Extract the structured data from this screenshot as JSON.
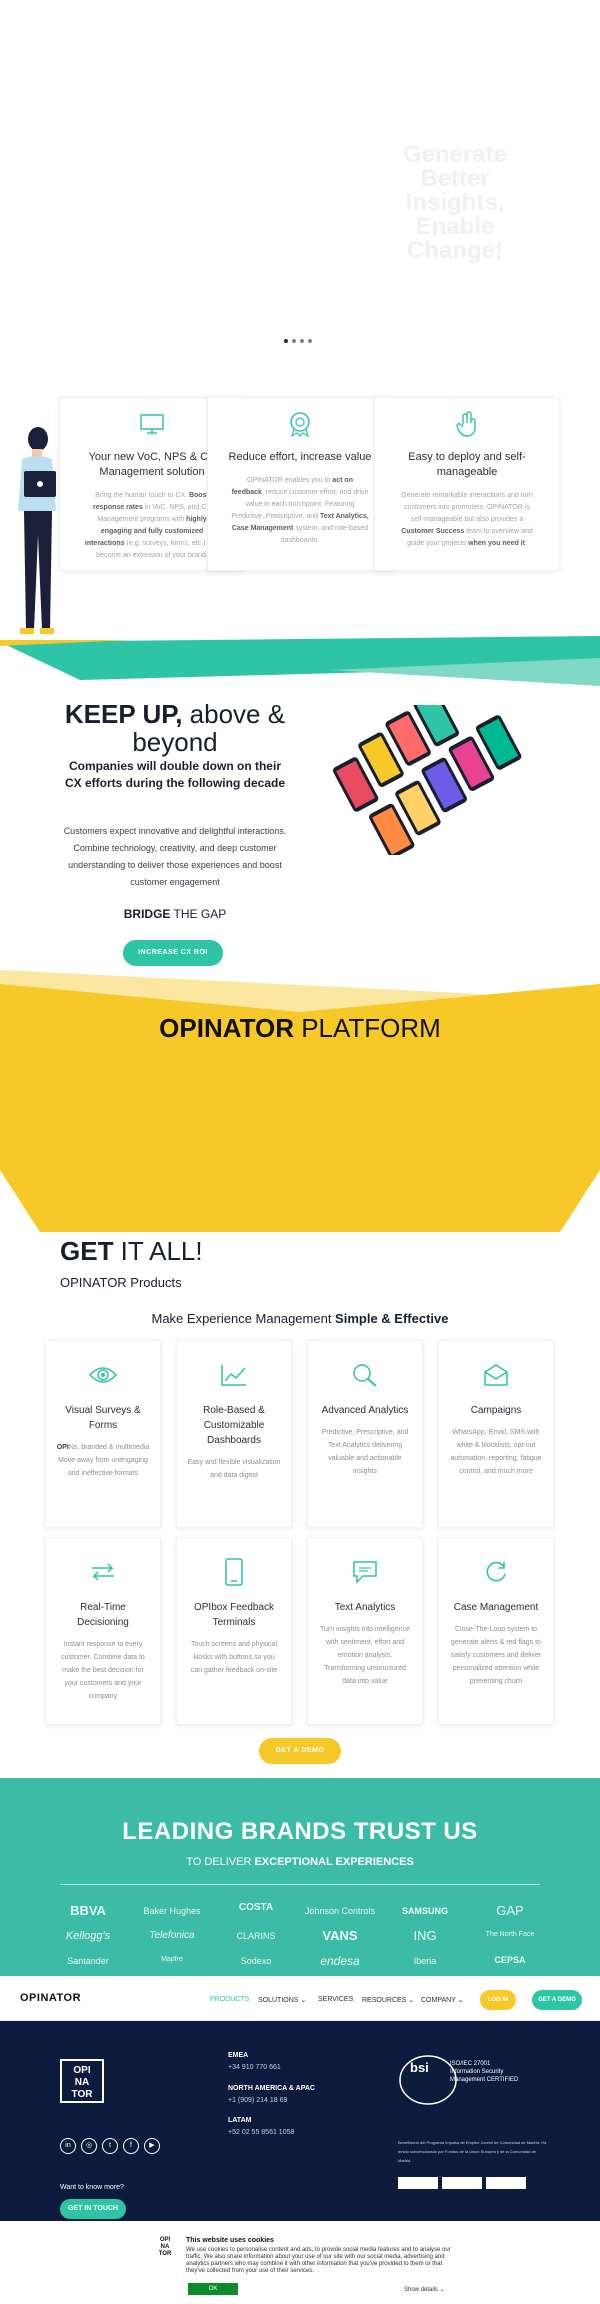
{
  "hero": {
    "lines": [
      "Generate",
      "Better",
      "Insights,",
      "Enable",
      "Change!"
    ]
  },
  "features": [
    {
      "icon": "monitor-icon",
      "title": "Your new VoC, NPS & CX Management solution",
      "desc": [
        "Bring the human touch to CX.",
        "Boost response rates",
        "in VoC, NPS, and CX Management programs with",
        "highly engaging and fully customized interactions",
        "(e.g. surveys, forms, etc.) that become an extension of your brand."
      ]
    },
    {
      "icon": "badge-icon",
      "title": "Reduce effort, increase value",
      "desc": [
        "OPINATOR enables you to",
        "act on feedback",
        ", reduce customer effort, and drive value in each touchpoint. Featuring Predictive, Prescriptive, and",
        "Text Analytics, Case Management",
        "system, and role-based dashboards."
      ]
    },
    {
      "icon": "hand-icon",
      "title": "Easy to deploy and self-manageable",
      "desc": [
        "Generate remarkable interactions and turn customers into promoters. OPINATOR is self-manageable but also provides a",
        "Customer Success",
        "team to overview and guide your projects",
        "when you need it",
        "."
      ]
    }
  ],
  "keepup": {
    "title_bold": "KEEP UP,",
    "title_rest": " above & beyond",
    "subtitle": "Companies will double down on their CX efforts during the following decade",
    "description": "Customers expect innovative and delightful interactions. Combine technology, creativity, and deep customer understanding to deliver those experiences and boost customer engagement",
    "bridge_bold": "BRIDGE",
    "bridge_rest": " THE GAP",
    "cta": "INCREASE CX ROI"
  },
  "platform": {
    "bold": "OPINATOR",
    "rest": " PLATFORM"
  },
  "getall": {
    "title_bold": "GET",
    "title_rest": " IT ALL!",
    "subtitle": "OPINATOR Products",
    "tag_rest": "Make Experience Management ",
    "tag_bold": "Simple & Effective"
  },
  "products": [
    {
      "icon": "eye-icon",
      "title": "Visual Surveys & Forms",
      "desc_bold": "OPI",
      "desc": "Ns, branded & multimedia Move away from unengaging and ineffective formats"
    },
    {
      "icon": "chart-line-icon",
      "title": "Role-Based & Customizable Dashboards",
      "desc_bold": "",
      "desc": "Easy and flexible visualization and data digest"
    },
    {
      "icon": "magnifier-icon",
      "title": "Advanced Analytics",
      "desc_bold": "",
      "desc": "Predictive, Prescriptive, and Text Analytics delivering valuable and actionable insights"
    },
    {
      "icon": "envelope-icon",
      "title": "Campaigns",
      "desc_bold": "",
      "desc": "WhatsApp, Email, SMS with white & blocklists, opt-out automation, reporting, fatigue control, and much more"
    },
    {
      "icon": "arrows-icon",
      "title": "Real-Time Decisioning",
      "desc_bold": "",
      "desc": "Instant response to every customer. Combine data to make the best decision for your customers and your company"
    },
    {
      "icon": "tablet-icon",
      "title": "OPIbox Feedback Terminals",
      "desc_bold": "",
      "desc": "Touch screens and physical kiosks with buttons so you can gather feedback on-site"
    },
    {
      "icon": "speech-bubble-icon",
      "title": "Text Analytics",
      "desc_bold": "",
      "desc": "Turn insights into intelligence with sentiment, effort and emotion analysis. Transforming unstructured data into value"
    },
    {
      "icon": "refresh-icon",
      "title": "Case Management",
      "desc_bold": "",
      "desc": "Close-The-Loop system to generate alerts & red flags to satisfy customers and deliver personalized attention while preventing churn"
    }
  ],
  "demo_cta": "GET A DEMO",
  "brands": {
    "title": "LEADING BRANDS TRUST US",
    "sub_rest": "TO DELIVER ",
    "sub_bold": "EXCEPTIONAL EXPERIENCES",
    "logos": [
      "BBVA",
      "Baker Hughes",
      "COSTA",
      "Johnson Controls",
      "SAMSUNG",
      "GAP",
      "Kellogg's",
      "Telefonica",
      "CLARINS",
      "VANS",
      "ING",
      "The North Face",
      "Santander",
      "Mapfre",
      "Sodexo",
      "endesa",
      "Iberia",
      "CEPSA"
    ]
  },
  "nav": {
    "logo": "OPINATOR",
    "items": [
      "PRODUCTS",
      "SOLUTIONS ⌄",
      "SERVICES",
      "RESOURCES ⌄",
      "COMPANY ⌄"
    ],
    "login": "LOG IN",
    "demo": "GET A DEMO",
    "active_color": "#2ec4a6"
  },
  "footer": {
    "logo_lines": [
      "OPI",
      "NA",
      "TOR"
    ],
    "offices": [
      {
        "region": "EMEA",
        "phone": "+34 910 770 661"
      },
      {
        "region": "NORTH AMERICA & APAC",
        "phone": "+1 (909) 214 18 69"
      },
      {
        "region": "LATAM",
        "phone": "+52 02 55 8561 1058"
      }
    ],
    "social": [
      "in",
      "◎",
      "t",
      "f",
      "▶"
    ],
    "want_know": "Want to know more?",
    "get_touch": "GET IN TOUCH",
    "bsi_text": "ISO/IEC 27001 Information Security Management CERTIFIED",
    "small_text": "Beneficiario del Programa Impulsa de Empleo Juvenil de Comunidad de Madrid. Ha tenido subvencionado por Fondos de la Union Europea y de la Comunidad de Madrid."
  },
  "cookie": {
    "title": "This website uses cookies",
    "text": "We use cookies to personalise content and ads, to provide social media features and to analyse our traffic. We also share information about your use of our site with our social media, advertising and analytics partners who may combine it with other information that you've provided to them or that they've collected from your use of their services.",
    "ok": "OK",
    "details": "Show details ⌄"
  },
  "colors": {
    "teal": "#2ec4a6",
    "yellow": "#f7c928",
    "navy": "#0d1b3e"
  }
}
